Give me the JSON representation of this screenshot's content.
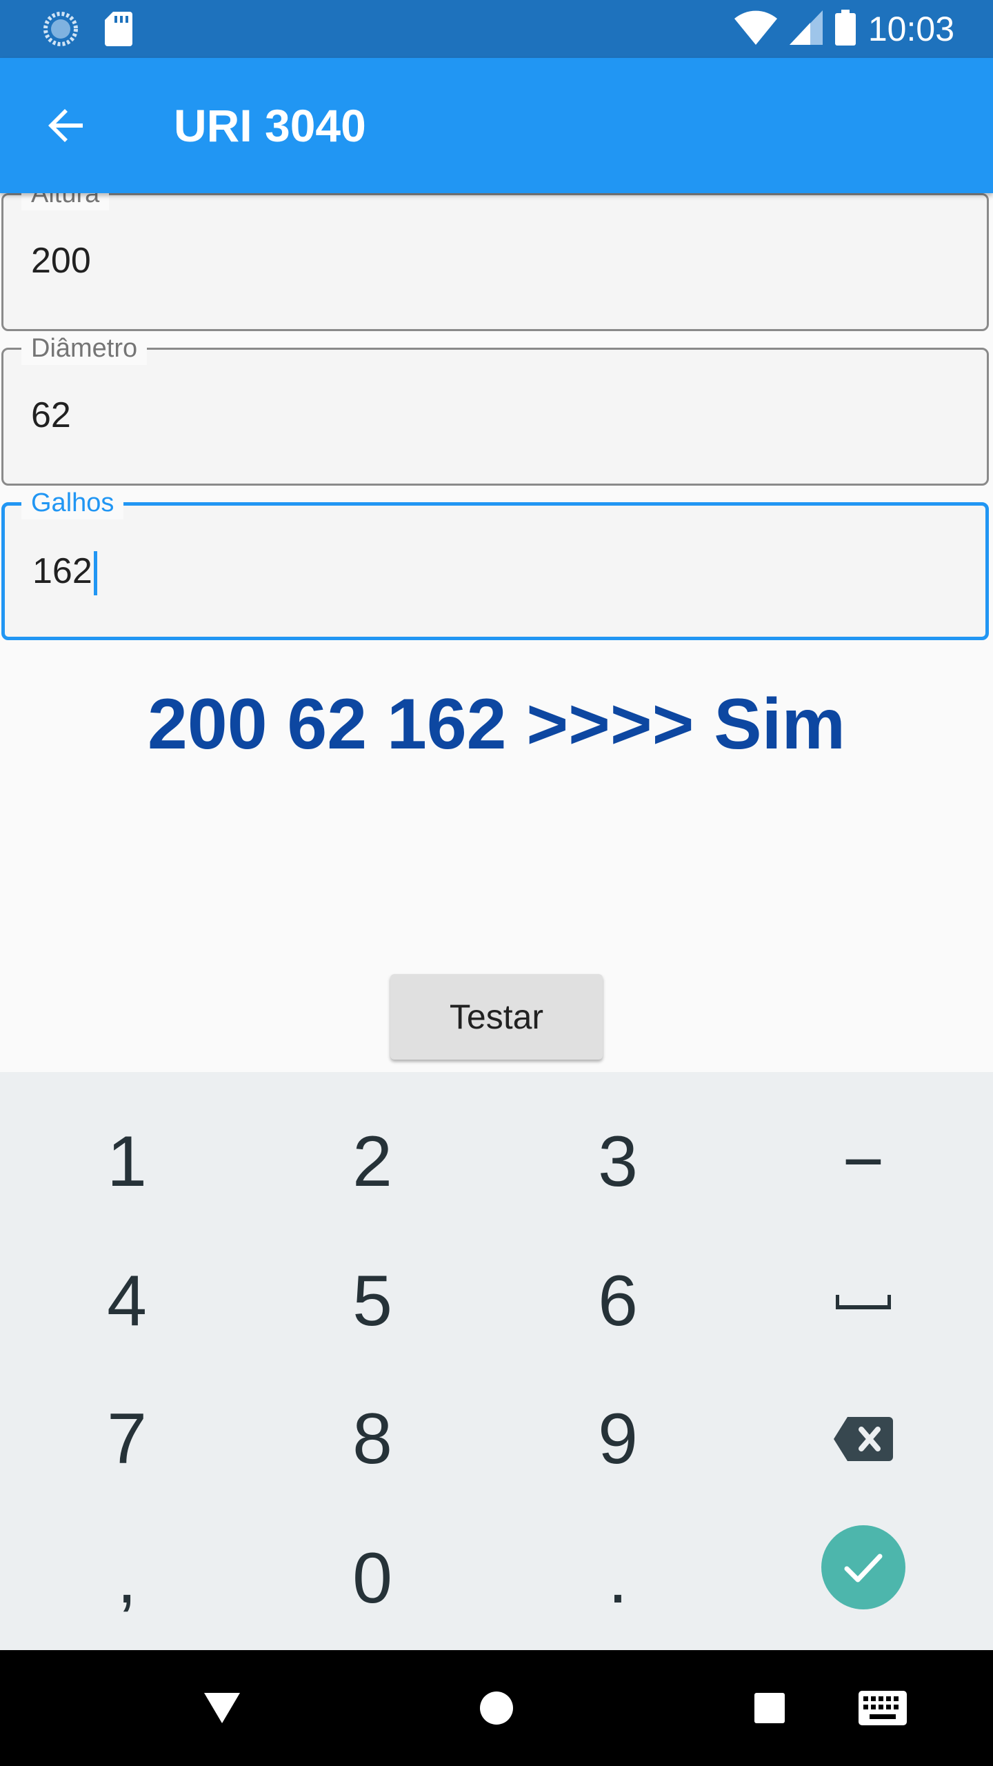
{
  "status_bar": {
    "time": "10:03",
    "icons": [
      "sync-icon",
      "sd-card-icon",
      "wifi-icon",
      "signal-icon",
      "battery-icon"
    ]
  },
  "app_bar": {
    "title": "URI 3040",
    "back_icon": "arrow-back-icon"
  },
  "form": {
    "fields": [
      {
        "label": "Altura",
        "value": "200"
      },
      {
        "label": "Diâmetro",
        "value": "62"
      },
      {
        "label": "Galhos",
        "value": "162"
      }
    ]
  },
  "result_text": "200 62 162 >>>> Sim",
  "test_button_label": "Testar",
  "keyboard": {
    "rows": [
      [
        "1",
        "2",
        "3",
        "−"
      ],
      [
        "4",
        "5",
        "6",
        "space-icon"
      ],
      [
        "7",
        "8",
        "9",
        "backspace-icon"
      ],
      [
        ",",
        "0",
        ".",
        "check-icon"
      ]
    ]
  },
  "colors": {
    "status_bar": "#1e72bd",
    "app_bar": "#2196f3",
    "accent": "#2196f3",
    "result_text": "#0d47a1",
    "enter_key": "#4db6ac",
    "keyboard_bg": "#eceff1"
  },
  "nav_bar": {
    "icons": [
      "back-triangle-icon",
      "home-circle-icon",
      "recents-square-icon",
      "keyboard-icon"
    ]
  }
}
